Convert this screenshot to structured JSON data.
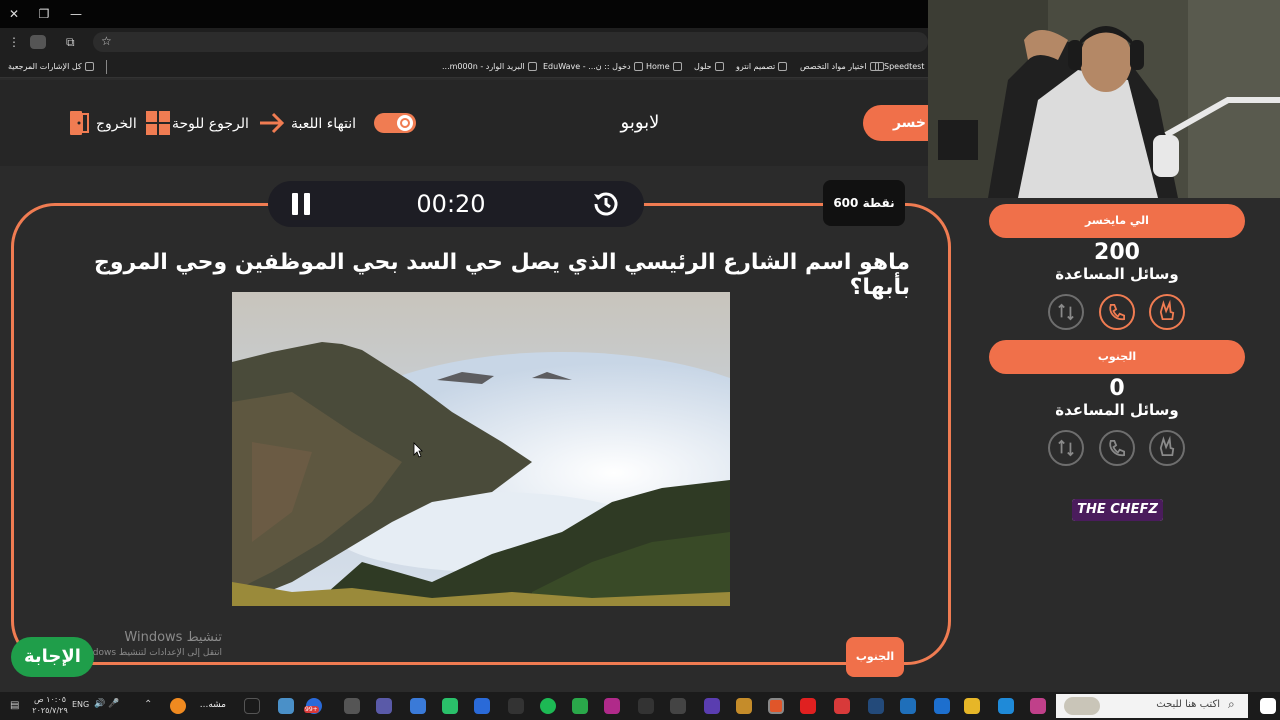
{
  "browser": {
    "bookmarks": [
      "Speedtest",
      "اختيار مواد التخصص",
      "تصميم انترو",
      "حلول",
      "Home",
      "دخول :: ن... - EduWave",
      "البريد الوارد - m000n..."
    ],
    "all_bookmarks_label": "كل الإشارات المرجعية"
  },
  "header": {
    "right_team_partial": "خسر",
    "title": "لابوبو",
    "end_game": "انتهاء اللعبة",
    "back_to_board": "الرجوع للوحة",
    "exit": "الخروج"
  },
  "timer": {
    "time": "00:20"
  },
  "points": "600 نقطة",
  "question": "ماهو اسم الشارع الرئيسي الذي يصل حي السد بحي الموظفين وحي المروج بأبها؟",
  "watermark": {
    "title": "تنشيط Windows",
    "subtitle": "انتقل إلى الإعدادات لتنشيط Windows."
  },
  "answer_button": "الإجابة",
  "category_badge": "الجنوب",
  "teams": [
    {
      "name": "الي مايخسر",
      "score": "200",
      "aids_label": "وسائل المساعدة"
    },
    {
      "name": "الجنوب",
      "score": "0",
      "aids_label": "وسائل المساعدة"
    }
  ],
  "sponsor": {
    "logo_text": "THE CHEFZ"
  },
  "taskbar": {
    "search_placeholder": "اكتب هنا للبحث",
    "lang": "ENG",
    "time": "١٠:٠٥ ص",
    "date": "٢٠٢٥/٧/٢٩",
    "running_app": "مشه...",
    "notif": "99+"
  },
  "colors": {
    "accent": "#f07c52",
    "background": "#2b2b2b"
  }
}
